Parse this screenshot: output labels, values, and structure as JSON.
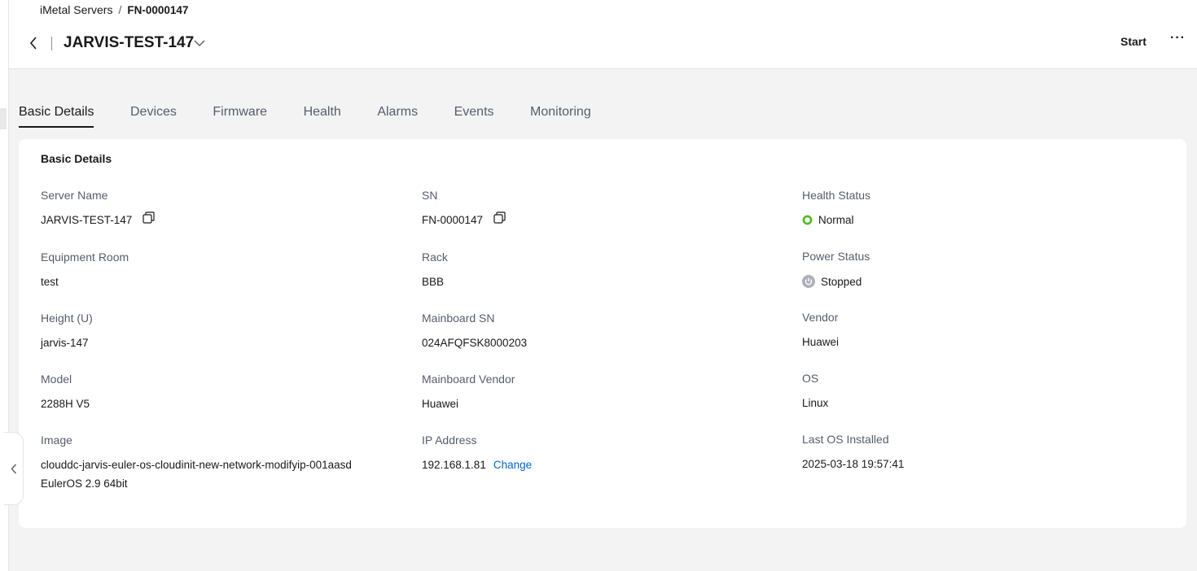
{
  "breadcrumb": {
    "parent": "iMetal Servers",
    "separator": "/",
    "current": "FN-0000147"
  },
  "header": {
    "title": "JARVIS-TEST-147",
    "start_label": "Start",
    "more_label": "···"
  },
  "tabs": [
    {
      "label": "Basic Details",
      "active": true
    },
    {
      "label": "Devices"
    },
    {
      "label": "Firmware"
    },
    {
      "label": "Health"
    },
    {
      "label": "Alarms"
    },
    {
      "label": "Events"
    },
    {
      "label": "Monitoring"
    }
  ],
  "card": {
    "title": "Basic Details",
    "fields": {
      "server_name": {
        "label": "Server Name",
        "value": "JARVIS-TEST-147"
      },
      "sn": {
        "label": "SN",
        "value": "FN-0000147"
      },
      "health_status": {
        "label": "Health Status",
        "value": "Normal"
      },
      "equipment_room": {
        "label": "Equipment Room",
        "value": "test"
      },
      "rack": {
        "label": "Rack",
        "value": "BBB"
      },
      "power_status": {
        "label": "Power Status",
        "value": "Stopped"
      },
      "height": {
        "label": "Height (U)",
        "value": "jarvis-147"
      },
      "mainboard_sn": {
        "label": "Mainboard SN",
        "value": "024AFQFSK8000203"
      },
      "vendor": {
        "label": "Vendor",
        "value": "Huawei"
      },
      "model": {
        "label": "Model",
        "value": "2288H V5"
      },
      "mainboard_vendor": {
        "label": "Mainboard Vendor",
        "value": "Huawei"
      },
      "os": {
        "label": "OS",
        "value": "Linux"
      },
      "image": {
        "label": "Image",
        "value": "clouddc-jarvis-euler-os-cloudinit-new-network-modifyip-001aasd",
        "value_line2": "EulerOS 2.9 64bit"
      },
      "ip_address": {
        "label": "IP Address",
        "value": "192.168.1.81",
        "change_label": "Change"
      },
      "last_os_installed": {
        "label": "Last OS Installed",
        "value": "2025-03-18 19:57:41"
      }
    }
  },
  "colors": {
    "accent": "#0066cc",
    "health_normal": "#50b91f",
    "power_stopped": "#adb0b8"
  }
}
